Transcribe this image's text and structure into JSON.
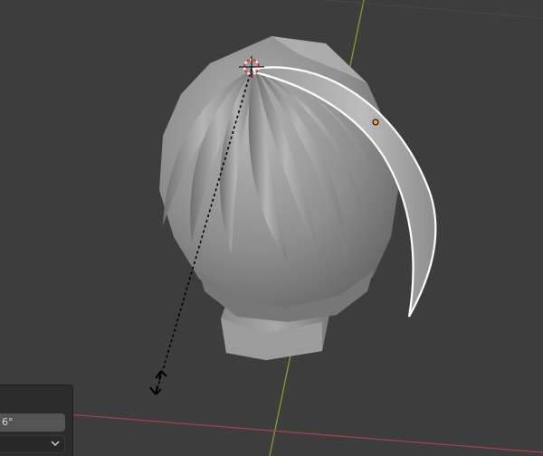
{
  "viewport": {
    "background": "#3d3d3d",
    "x_axis_color": "#a1424e",
    "y_axis_color": "#7ba02c"
  },
  "redo_panel": {
    "angle_value": "6°",
    "dropdown_value": ""
  },
  "icons": {
    "cursor": "3d-cursor-icon",
    "chevron": "chevron-down-icon",
    "origin": "object-origin-icon"
  }
}
